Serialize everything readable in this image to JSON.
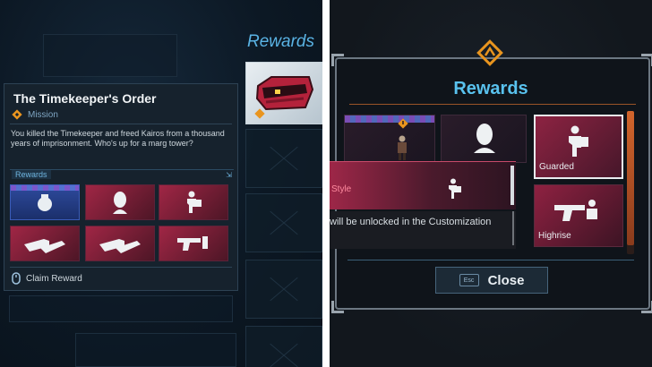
{
  "left": {
    "rewards_heading": "Rewards",
    "mission": {
      "title": "The Timekeeper's Order",
      "tag": "Mission",
      "description": "You killed the Timekeeper and freed Kairos from a thousand years of imprisonment. Who's up for a marg tower?",
      "rewards_label": "Rewards",
      "claim_label": "Claim Reward"
    }
  },
  "right": {
    "title": "Rewards",
    "items": [
      {
        "name": "",
        "kind": "weapon-bundle"
      },
      {
        "name": "",
        "kind": "head"
      },
      {
        "name": "Guarded",
        "kind": "pose"
      },
      {
        "name": "Highrise",
        "kind": "pistol-pose"
      }
    ],
    "tooltip": {
      "title": "Style",
      "description": "will be unlocked in the Customization"
    },
    "close_key": "Esc",
    "close_label": "Close"
  },
  "colors": {
    "accent_blue": "#59c2ee",
    "reward_red": "#8e2141",
    "orange_accent": "#e07a33"
  }
}
